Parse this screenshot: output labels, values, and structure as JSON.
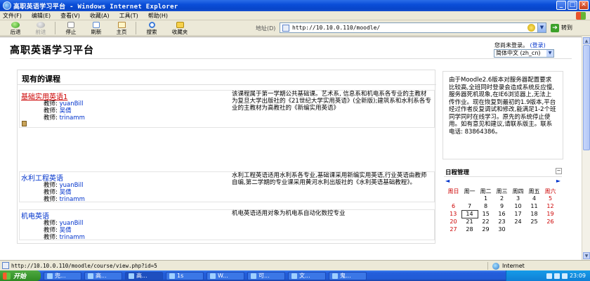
{
  "window": {
    "title": "高职英语学习平台 - Windows Internet Explorer",
    "buttons": [
      "_",
      "□",
      "✕"
    ]
  },
  "menu": [
    "文件(F)",
    "编辑(E)",
    "查看(V)",
    "收藏(A)",
    "工具(T)",
    "帮助(H)"
  ],
  "toolbar": {
    "back": "后退",
    "forward": "前进",
    "stop": "停止",
    "refresh": "刷新",
    "home": "主页",
    "search": "搜索",
    "favorites": "收藏夹"
  },
  "address": {
    "label": "地址(D)",
    "url": "http://10.10.0.110/moodle/",
    "go": "转到"
  },
  "page": {
    "site_title": "高职英语学习平台",
    "login_text": "您尚未登录。",
    "login_link": "(登录)",
    "language": "简体中文 (zh_cn)",
    "courses_heading": "现有的课程",
    "courses": [
      {
        "name": "基础实用英语1",
        "teachers": [
          {
            "role": "教师: ",
            "name": "yuanBill"
          },
          {
            "role": "教师: ",
            "name": "吴倩"
          },
          {
            "role": "教师: ",
            "name": "trinamm"
          }
        ],
        "description": "该课程属于第一学期公共基础课。艺术系, 信息系和机电系各专业的主教材为复旦大学出版社的《21世纪大学实用英语》(全新版);建筑系和水利系各专业的主教材为高教社的《新编实用英语》"
      },
      {
        "name": "水利工程英语",
        "teachers": [
          {
            "role": "教师: ",
            "name": "yuanBill"
          },
          {
            "role": "教师: ",
            "name": "吴倩"
          },
          {
            "role": "教师: ",
            "name": "trinamm"
          }
        ],
        "description": "水利工程英语适用水利系各专业,基础课采用新编实用英语,行业英语由教师自编,第二学期的专业课采用黄河水利出版社的《水利英语基础教程》。"
      },
      {
        "name": "机电英语",
        "teachers": [
          {
            "role": "教师: ",
            "name": "yuanBill"
          },
          {
            "role": "教师: ",
            "name": "吴倩"
          },
          {
            "role": "教师: ",
            "name": "trinamm"
          }
        ],
        "description": "机电英语适用对象为机电系自动化数控专业"
      }
    ],
    "notice": "由于Moodle2.6版本对服务器配置要求比较高,全班同时登录会造成系统反应慢,服务器死机现象,在IE6浏览器上,无法上传作业。现在恢复到最初的1.9版本,平台经过作者反复调试和修改,能满足1-2个班同学同时在线学习。原先的系统停止使用。如有意见和建议,请联系版主。联系电话: 83864386。",
    "calendar": {
      "title": "日程管理",
      "collapse": "−",
      "prev": "◄",
      "next": "►",
      "weekdays": [
        "周日",
        "周一",
        "周二",
        "周三",
        "周四",
        "周五",
        "周六"
      ],
      "weeks": [
        [
          "",
          "",
          "1",
          "2",
          "3",
          "4",
          "5"
        ],
        [
          "6",
          "7",
          "8",
          "9",
          "10",
          "11",
          "12"
        ],
        [
          "13",
          "14",
          "15",
          "16",
          "17",
          "18",
          "19"
        ],
        [
          "20",
          "21",
          "22",
          "23",
          "24",
          "25",
          "26"
        ],
        [
          "27",
          "28",
          "29",
          "30",
          "",
          "",
          ""
        ]
      ],
      "today": "14"
    }
  },
  "status": {
    "url": "http://10.10.0.110/moodle/course/view.php?id=5",
    "zone": "Internet"
  },
  "taskbar": {
    "start": "开始",
    "tasks": [
      "兜...",
      "高...",
      "高...",
      "1s",
      "W...",
      "可...",
      "文...",
      "鬼..."
    ],
    "clock": "23:09"
  }
}
